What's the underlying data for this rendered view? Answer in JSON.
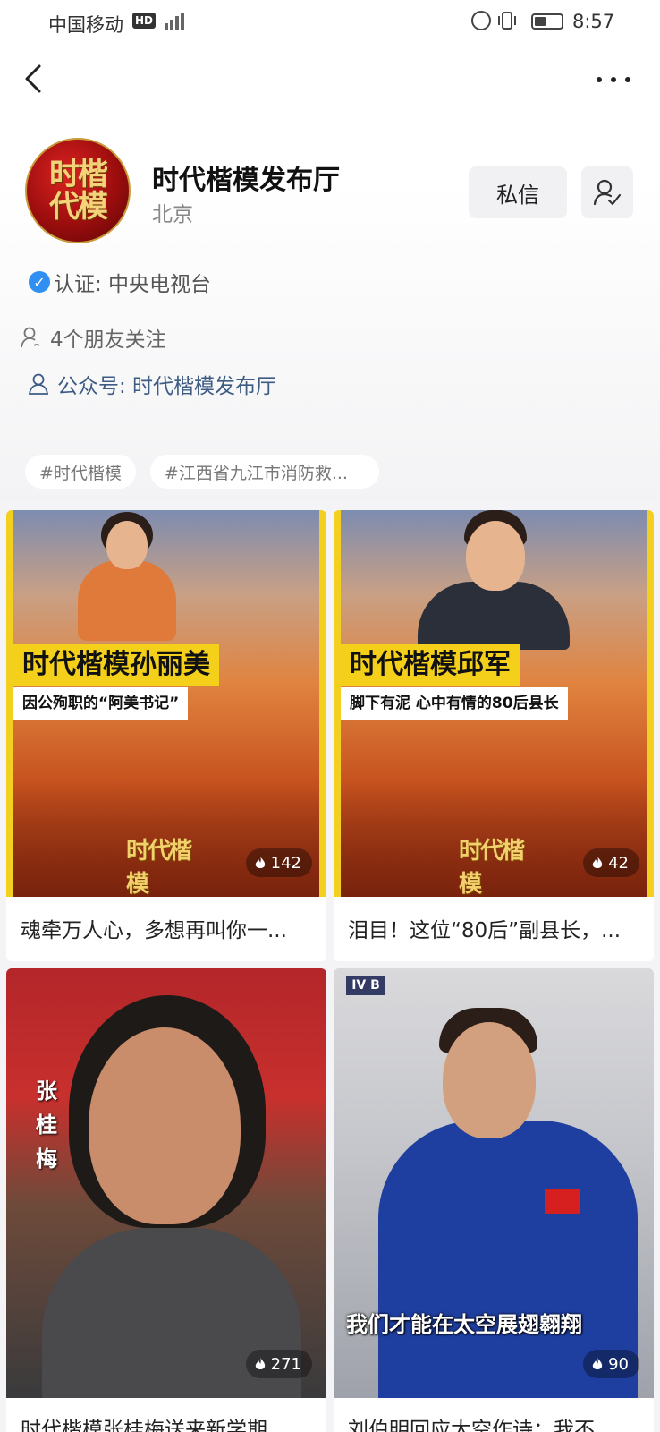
{
  "status_bar": {
    "carrier": "中国移动",
    "hd": "HD",
    "network": "4G",
    "time": "8:57"
  },
  "profile": {
    "avatar_text": "时楷代模",
    "name": "时代楷模发布厅",
    "location": "北京",
    "message_button": "私信",
    "verification": "认证: 中央电视台",
    "friends_following": "4个朋友关注",
    "public_account": "公众号: 时代楷模发布厅"
  },
  "tags": [
    "#时代楷模",
    "#江西省九江市消防救..."
  ],
  "videos": [
    {
      "poster_title": "时代楷模孙丽美",
      "poster_subtitle": "因公殉职的“阿美书记”",
      "logo": "时代楷模",
      "heat": "142",
      "title": "魂牵万人心，多想再叫你一..."
    },
    {
      "poster_title": "时代楷模邱军",
      "poster_subtitle": "脚下有泥 心中有情的80后县长",
      "logo": "时代楷模",
      "heat": "42",
      "title": "泪目！这位“80后”副县长，..."
    },
    {
      "overlay_text": "张桂梅",
      "heat": "271",
      "title": "时代楷模张桂梅送来新学期..."
    },
    {
      "overlay_text": "我们才能在太空展翅翱翔",
      "station_label": "IV B",
      "heat": "90",
      "title": "刘伯明回应太空作诗：我不..."
    }
  ],
  "colors": {
    "accent_yellow": "#f5d01b",
    "verify_blue": "#2f8ff2",
    "link_blue": "#3e5b84"
  }
}
